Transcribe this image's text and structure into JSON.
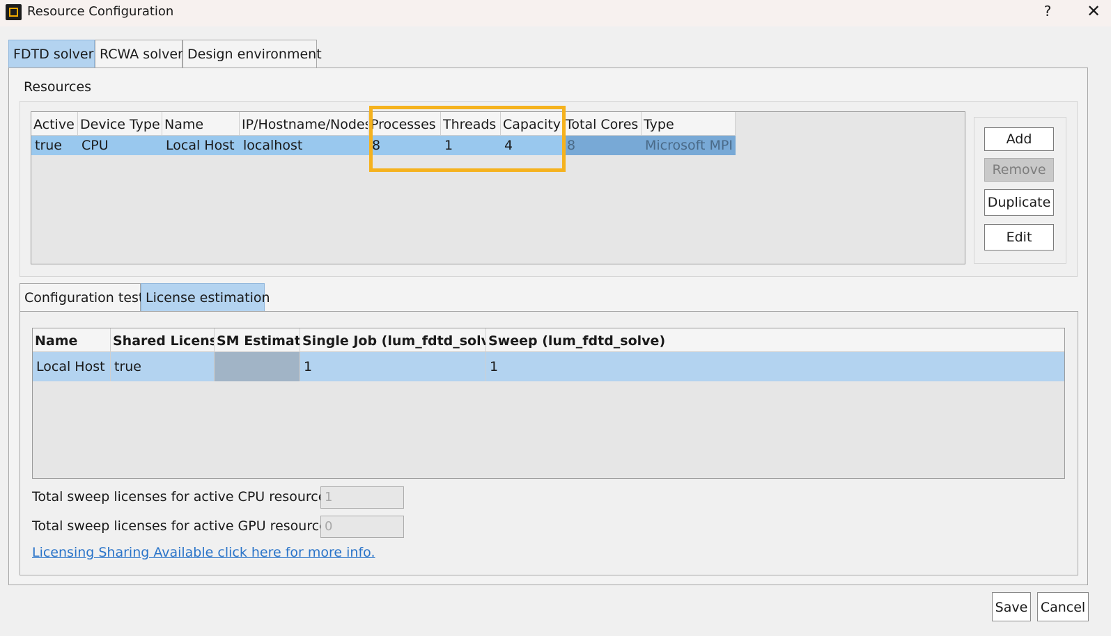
{
  "window": {
    "title": "Resource Configuration",
    "help_label": "?",
    "close_label": "✕"
  },
  "top_tabs": [
    {
      "label": "FDTD solver",
      "active": true
    },
    {
      "label": "RCWA solver",
      "active": false
    },
    {
      "label": "Design environment",
      "active": false
    }
  ],
  "resources": {
    "group_label": "Resources",
    "columns": [
      "Active",
      "Device Type",
      "Name",
      "IP/Hostname/Nodes",
      "Processes",
      "Threads",
      "Capacity",
      "Total Cores",
      "Type"
    ],
    "rows": [
      [
        "true",
        "CPU",
        "Local Host",
        "localhost",
        "8",
        "1",
        "4",
        "8",
        "Microsoft MPI"
      ]
    ],
    "buttons": {
      "add": "Add",
      "remove": "Remove",
      "duplicate": "Duplicate",
      "edit": "Edit"
    },
    "highlight_color": "#f5b21e"
  },
  "lower_tabs": [
    {
      "label": "Configuration test",
      "active": false
    },
    {
      "label": "License estimation",
      "active": true
    }
  ],
  "license": {
    "columns": [
      "Name",
      "Shared License",
      "SM Estimate",
      "Single Job (lum_fdtd_solve)",
      "Sweep (lum_fdtd_solve)"
    ],
    "rows": [
      [
        "Local Host",
        "true",
        "",
        "1",
        "1"
      ]
    ],
    "cpu_label": "Total sweep licenses for active CPU resources:",
    "cpu_value": "1",
    "gpu_label": "Total sweep licenses for active GPU resources:",
    "gpu_value": "0",
    "link_text": "Licensing Sharing Available click here for more info."
  },
  "footer": {
    "save": "Save",
    "cancel": "Cancel"
  },
  "colors": {
    "selection": "#99c8ee",
    "active_tab": "#b3d3f0",
    "link": "#2a74c9"
  }
}
